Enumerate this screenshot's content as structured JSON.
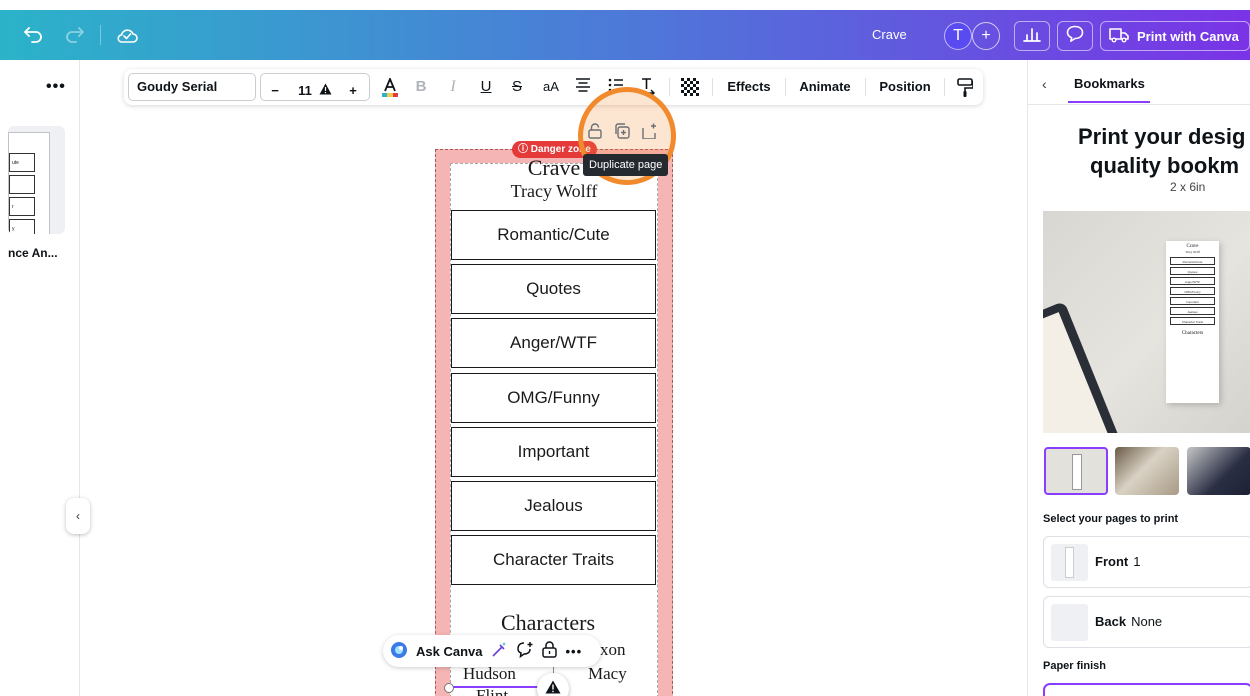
{
  "topbar": {
    "doc_title": "Crave",
    "avatar_letter": "T",
    "add_label": "+",
    "print_label": "Print with Canva"
  },
  "left_panel": {
    "more_label": "•••",
    "design_name": "nce An...",
    "thumb_rows": [
      "ute",
      "",
      "r",
      "y"
    ],
    "collapse_label": "‹"
  },
  "toolbar": {
    "font": "Goudy Serial",
    "size_minus": "−",
    "size": "11",
    "size_plus": "+",
    "case": "aA",
    "effects": "Effects",
    "animate": "Animate",
    "position": "Position"
  },
  "page_tools": {
    "tooltip": "Duplicate page"
  },
  "bookmark": {
    "danger_zone": "Danger zone",
    "title": "Crave",
    "author": "Tracy Wolff",
    "boxes": [
      "Romantic/Cute",
      "Quotes",
      "Anger/WTF",
      "OMG/Funny",
      "Important",
      "Jealous",
      "Character Traits"
    ],
    "characters_title": "Characters",
    "characters": [
      "Hudson",
      "Macy",
      "xon",
      "Flint"
    ]
  },
  "ask_canva": {
    "label": "Ask Canva"
  },
  "right_panel": {
    "back_label": "‹",
    "tab": "Bookmarks",
    "headline_1": "Print your desig",
    "headline_2": "quality bookm",
    "size": "2 x 6in",
    "mockup_rows": [
      "Romantic/Cute",
      "Quotes",
      "Anger/WTF",
      "OMG/Funny",
      "Important",
      "Jealous",
      "Character Traits"
    ],
    "mockup_title": "Crave",
    "mockup_author": "Tracy Wolff",
    "mockup_characters": "Characters",
    "select_pages_label": "Select your pages to print",
    "front_label": "Front",
    "front_value": "1",
    "back_label_text": "Back",
    "back_value": "None",
    "finish_label": "Paper finish"
  },
  "colors": {
    "accent": "#8b3dff",
    "highlight": "#f08a2c",
    "danger": "#e43a3a",
    "bleed": "#f5b5b5"
  }
}
